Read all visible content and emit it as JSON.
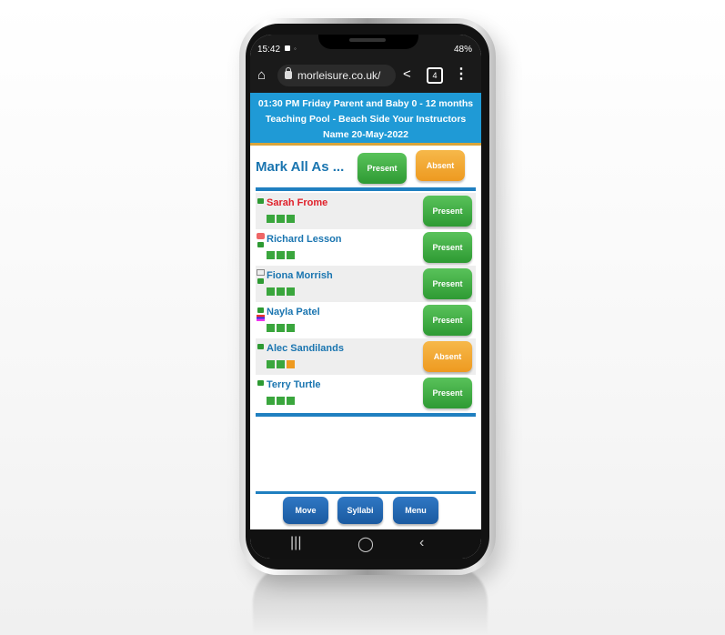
{
  "status": {
    "time": "15:42",
    "right": "48%"
  },
  "browser": {
    "url": "morleisure.co.uk/",
    "tab_count": "4"
  },
  "header": {
    "line1": "01:30 PM Friday Parent and Baby 0 - 12 months",
    "line2": "Teaching Pool - Beach Side Your Instructors",
    "line3": "Name 20-May-2022"
  },
  "markall": {
    "label": "Mark All As ...",
    "present": "Present",
    "absent": "Absent"
  },
  "roster": [
    {
      "name": "Sarah Frome",
      "status": "Present",
      "dots": [
        "green",
        "green",
        "green"
      ]
    },
    {
      "name": "Richard Lesson",
      "status": "Present",
      "dots": [
        "green",
        "green",
        "green"
      ]
    },
    {
      "name": "Fiona Morrish",
      "status": "Present",
      "dots": [
        "green",
        "green",
        "green"
      ]
    },
    {
      "name": "Nayla Patel",
      "status": "Present",
      "dots": [
        "green",
        "green",
        "green"
      ]
    },
    {
      "name": "Alec Sandilands",
      "status": "Absent",
      "dots": [
        "green",
        "green",
        "orange"
      ]
    },
    {
      "name": "Terry Turtle",
      "status": "Present",
      "dots": [
        "green",
        "green",
        "green"
      ]
    }
  ],
  "footer": {
    "move": "Move",
    "syllabi": "Syllabi",
    "menu": "Menu"
  },
  "nav": {
    "recents": "|||",
    "home": "◯",
    "back": "‹"
  },
  "colors": {
    "header_bg": "#1f9ad6",
    "present": "#2e9a33",
    "absent": "#ee9a20",
    "name": "#1a75b0",
    "alert_name": "#e0202a"
  }
}
